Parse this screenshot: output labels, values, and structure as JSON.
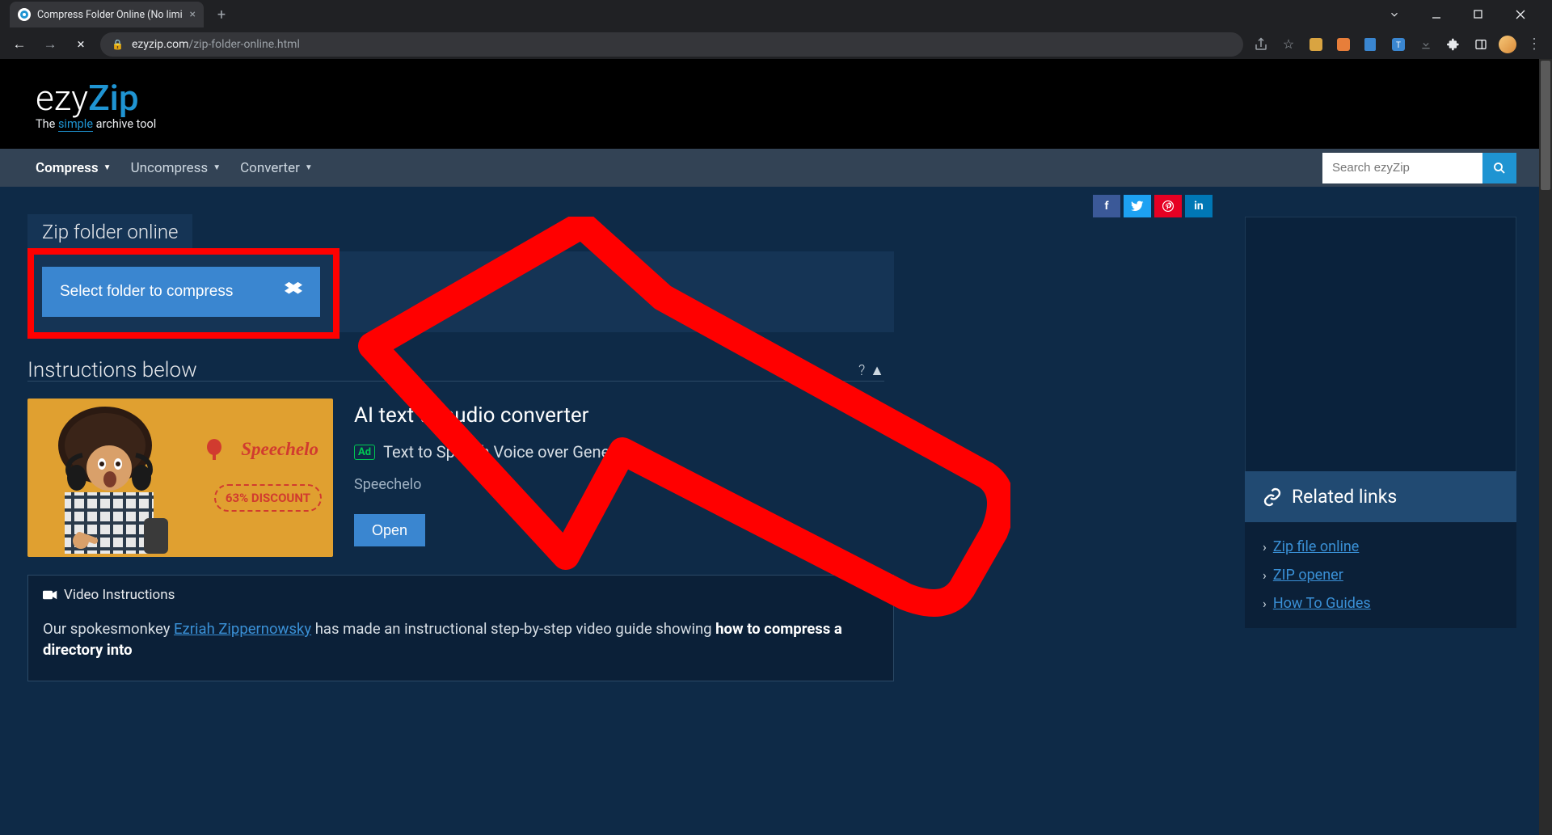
{
  "browser": {
    "tab_title": "Compress Folder Online (No limi",
    "url_host": "ezyzip.com",
    "url_path": "/zip-folder-online.html"
  },
  "logo": {
    "part1": "ezy",
    "part2": "Zip",
    "tagline_pre": "The ",
    "tagline_mid": "simple",
    "tagline_post": " archive tool"
  },
  "nav": {
    "compress": "Compress",
    "uncompress": "Uncompress",
    "converter": "Converter",
    "search_placeholder": "Search ezyZip"
  },
  "page_title": "Zip folder online",
  "select_button": "Select folder to compress",
  "instructions_heading": "Instructions below",
  "instructions_toggle": "?",
  "ad": {
    "title": "AI text to audio converter",
    "badge": "Ad",
    "subtitle": "Text to Speech Voice over Generator",
    "vendor": "Speechelo",
    "open": "Open",
    "brand": "Speechelo",
    "discount": "63% DISCOUNT"
  },
  "video": {
    "heading": "Video Instructions",
    "text_pre": "Our spokesmonkey ",
    "text_link": "Ezriah Zippernowsky",
    "text_mid": " has made an instructional step-by-step video guide showing ",
    "text_bold": "how to compress a directory into"
  },
  "related": {
    "heading": "Related links",
    "links": [
      "Zip file online",
      "ZIP opener",
      "How To Guides"
    ]
  }
}
